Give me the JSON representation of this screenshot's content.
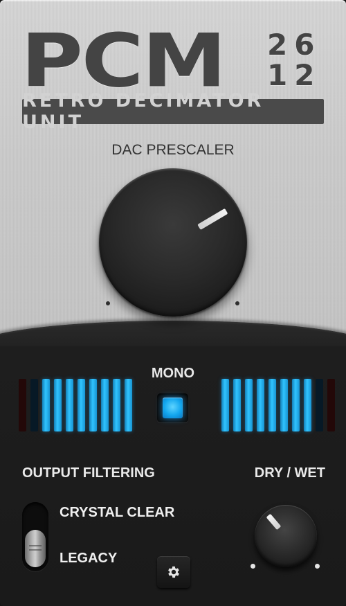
{
  "logo": {
    "word": "PCM",
    "digits_top": "26",
    "digits_bottom": "12",
    "subtitle": "RETRO DECIMATOR UNIT"
  },
  "dac": {
    "label": "DAC PRESCALER",
    "value_fraction": 0.72
  },
  "mono": {
    "label": "MONO",
    "enabled": true,
    "accent": "#2eb8ff"
  },
  "meters": {
    "left": {
      "segments": [
        "off-red",
        "off-blue",
        "on",
        "on",
        "on",
        "on",
        "on",
        "on",
        "on",
        "on"
      ]
    },
    "right": {
      "segments": [
        "on",
        "on",
        "on",
        "on",
        "on",
        "on",
        "on",
        "on",
        "off-blue",
        "off-red"
      ]
    }
  },
  "output_filtering": {
    "label": "OUTPUT FILTERING",
    "options": [
      "CRYSTAL CLEAR",
      "LEGACY"
    ],
    "selected": "LEGACY"
  },
  "dry_wet": {
    "label": "DRY / WET",
    "value_fraction": 0.35
  },
  "settings": {
    "icon": "gear-icon"
  }
}
